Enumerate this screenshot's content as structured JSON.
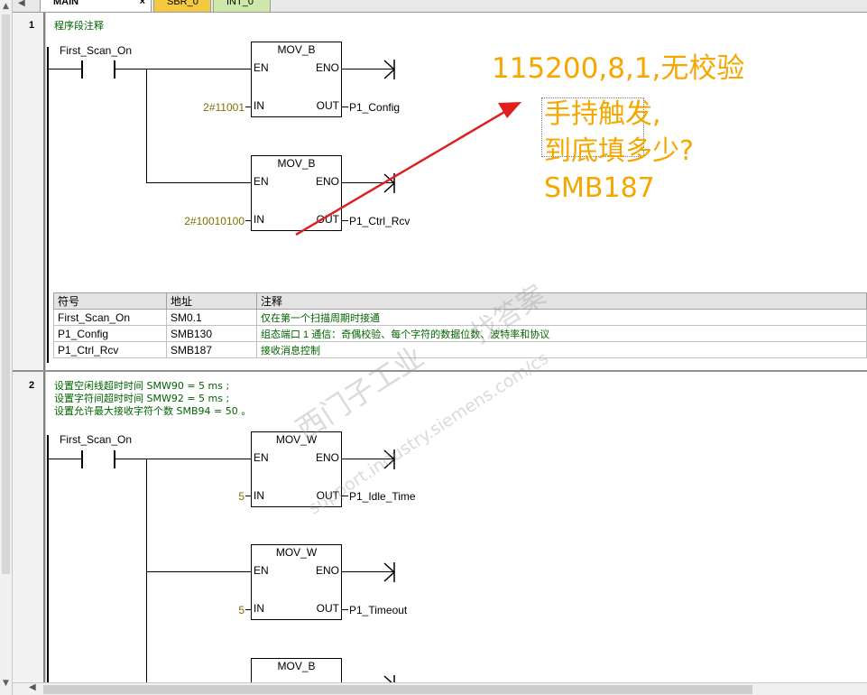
{
  "tabs": {
    "main": "MAIN",
    "main_close": "×",
    "sbr": "SBR_0",
    "int": "INT_0"
  },
  "networks": [
    {
      "number": "1",
      "comment": "程序段注释",
      "contact": "First_Scan_On",
      "blocks": [
        {
          "title": "MOV_B",
          "en": "EN",
          "eno": "ENO",
          "in_pin": "IN",
          "out_pin": "OUT",
          "in_value": "2#11001",
          "out_value": "P1_Config"
        },
        {
          "title": "MOV_B",
          "en": "EN",
          "eno": "ENO",
          "in_pin": "IN",
          "out_pin": "OUT",
          "in_value": "2#10010100",
          "out_value": "P1_Ctrl_Rcv"
        }
      ],
      "symbol_table": {
        "headers": [
          "符号",
          "地址",
          "注释"
        ],
        "rows": [
          [
            "First_Scan_On",
            "SM0.1",
            "仅在第一个扫描周期时接通"
          ],
          [
            "P1_Config",
            "SMB130",
            "组态端口 1 通信：奇偶校验、每个字符的数据位数、波特率和协议"
          ],
          [
            "P1_Ctrl_Rcv",
            "SMB187",
            "接收消息控制"
          ]
        ]
      }
    },
    {
      "number": "2",
      "comment_lines": [
        "设置空闲线超时时间 SMW90 = 5 ms ;",
        "设置字符间超时时间 SMW92 = 5 ms ;",
        "设置允许最大接收字符个数 SMB94 = 50 。"
      ],
      "contact": "First_Scan_On",
      "blocks": [
        {
          "title": "MOV_W",
          "en": "EN",
          "eno": "ENO",
          "in_pin": "IN",
          "out_pin": "OUT",
          "in_value": "5",
          "out_value": "P1_Idle_Time"
        },
        {
          "title": "MOV_W",
          "en": "EN",
          "eno": "ENO",
          "in_pin": "IN",
          "out_pin": "OUT",
          "in_value": "5",
          "out_value": "P1_Timeout"
        },
        {
          "title": "MOV_B"
        }
      ]
    }
  ],
  "annotations": {
    "line1": "115200,8,1,无校验",
    "line2": "手持触发,",
    "line3": "到底填多少?",
    "line4": "SMB187"
  },
  "watermark": {
    "text1": "找答案",
    "text2": "西门子工业",
    "text3": "support.industry.siemens.com/cs"
  },
  "colors": {
    "annotation": "#f5a700",
    "arrow": "#e02020",
    "comment": "#006400",
    "constant": "#807000"
  }
}
